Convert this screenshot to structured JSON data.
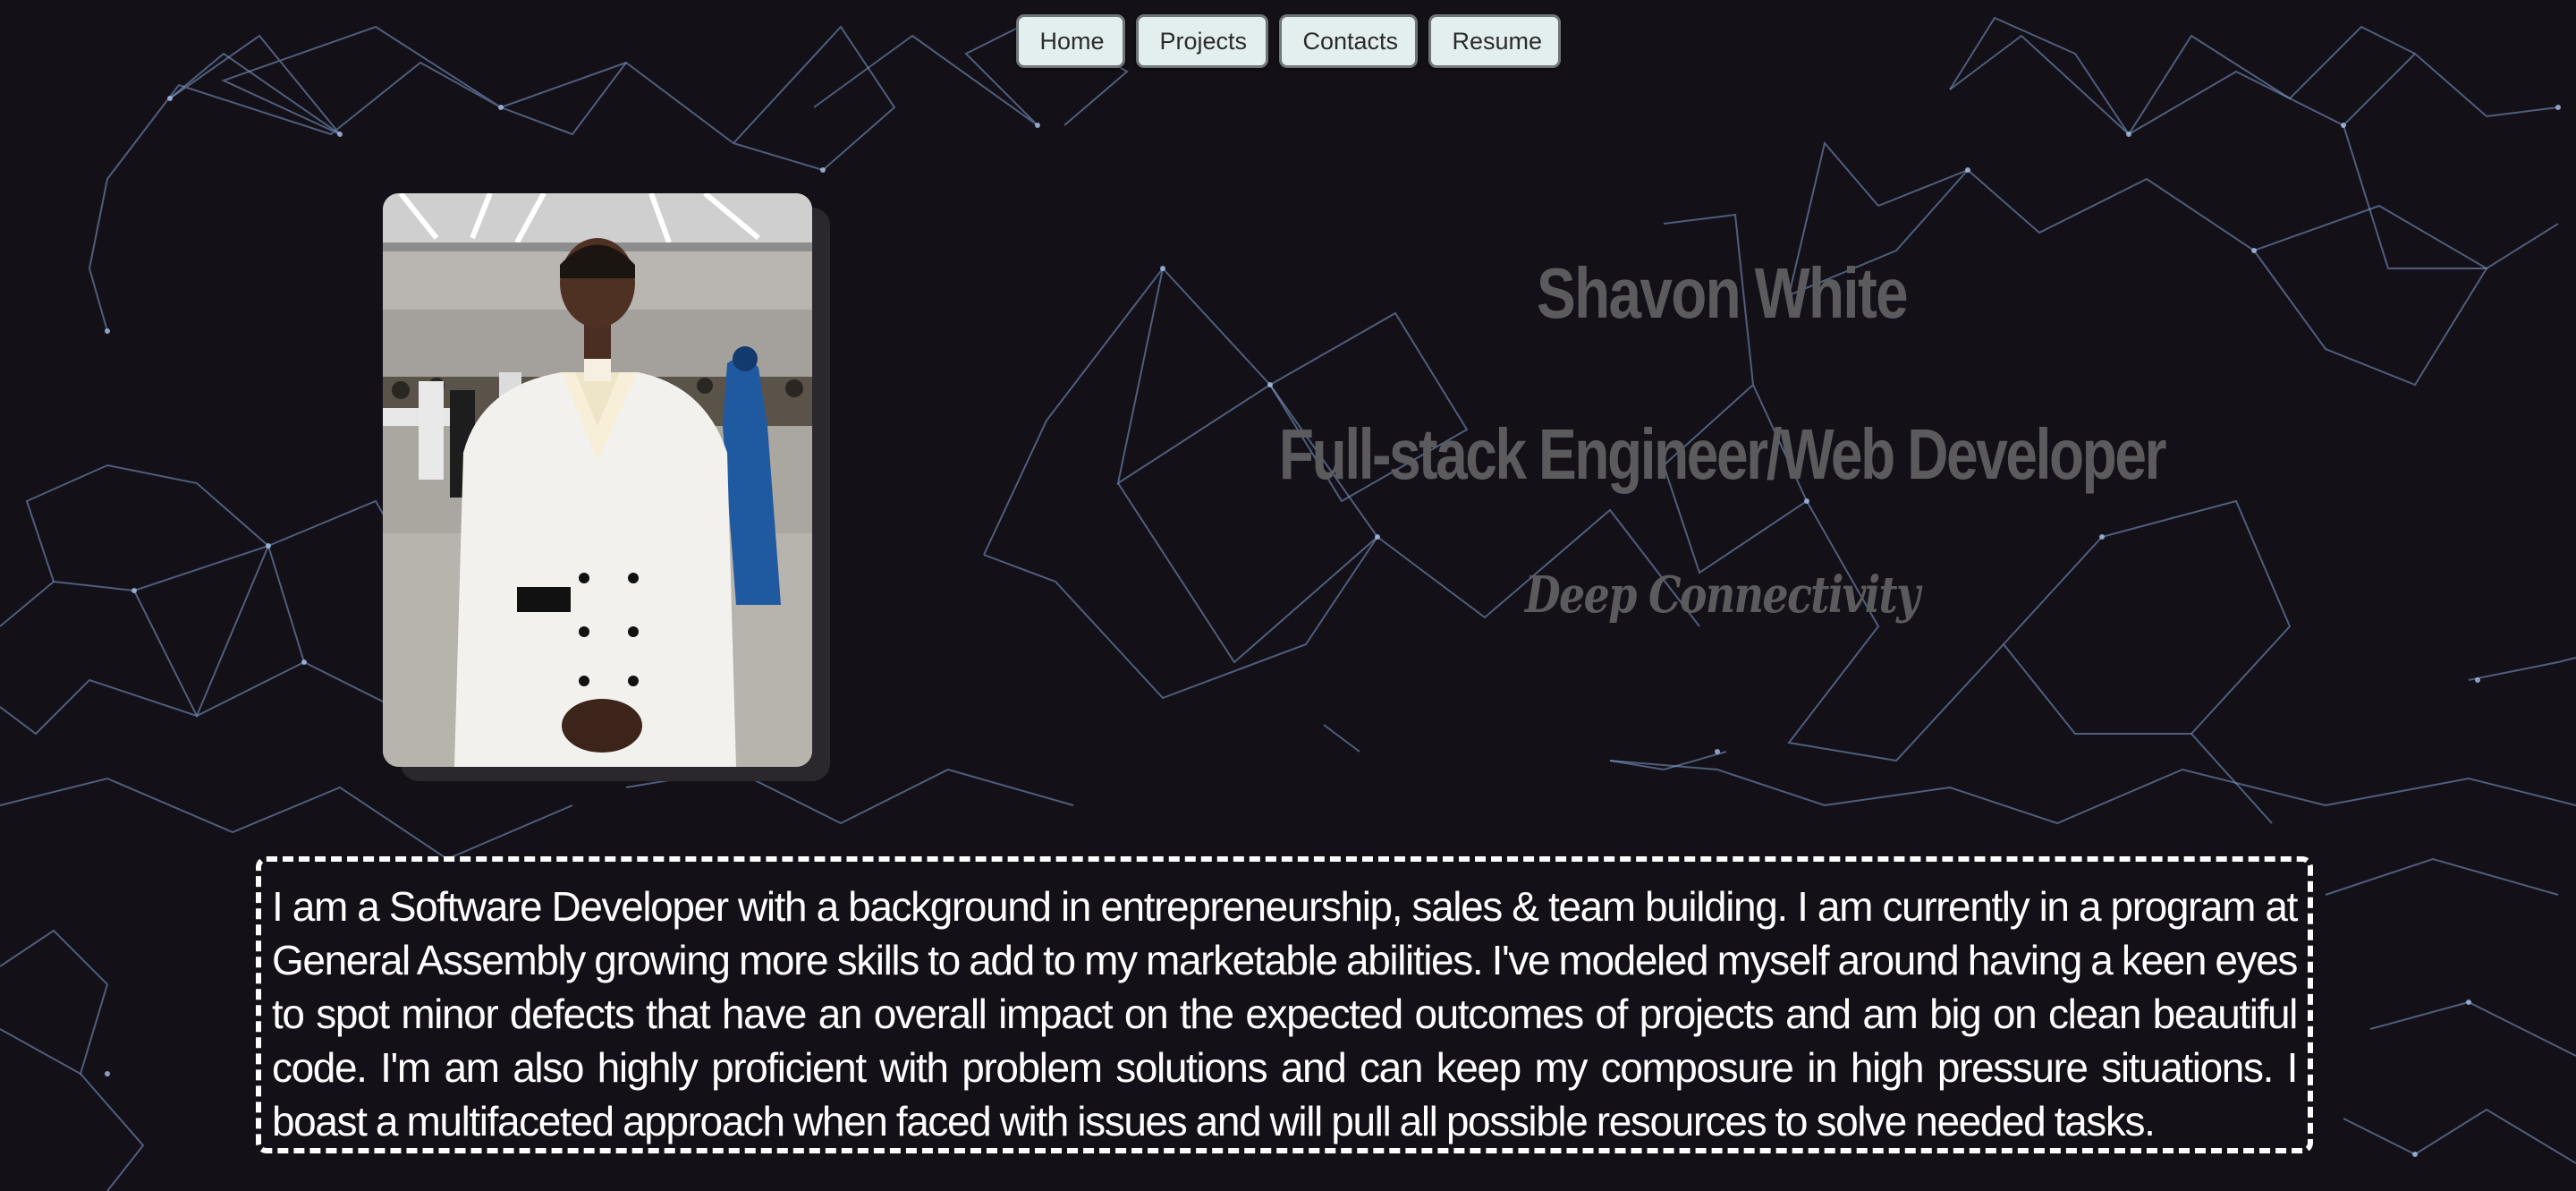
{
  "nav": {
    "items": [
      {
        "label": "Home"
      },
      {
        "label": "Projects"
      },
      {
        "label": "Contacts"
      },
      {
        "label": "Resume"
      }
    ]
  },
  "hero": {
    "name": "Shavon White",
    "title": "Full-stack Engineer/Web Developer",
    "tagline": "Deep Connectivity"
  },
  "bio": {
    "text": "I am a Software Developer with a background in entrepreneurship, sales & team building. I am currently in a program at General Assembly growing more skills to add to my marketable abilities. I've modeled myself around having a keen eyes to spot minor defects that have an overall impact on the expected outcomes of projects and am big on clean beautiful code. I'm am also highly proficient with problem solutions and can keep my composure in high pressure situations. I boast a multifaceted approach when faced with issues and will pull all possible resources to solve needed tasks."
  },
  "colors": {
    "background": "#141018",
    "network_lines": "#7f9fd0",
    "nav_button_bg": "#e2efee",
    "hero_text": "#5b5b5e",
    "bio_text": "#ffffff"
  }
}
